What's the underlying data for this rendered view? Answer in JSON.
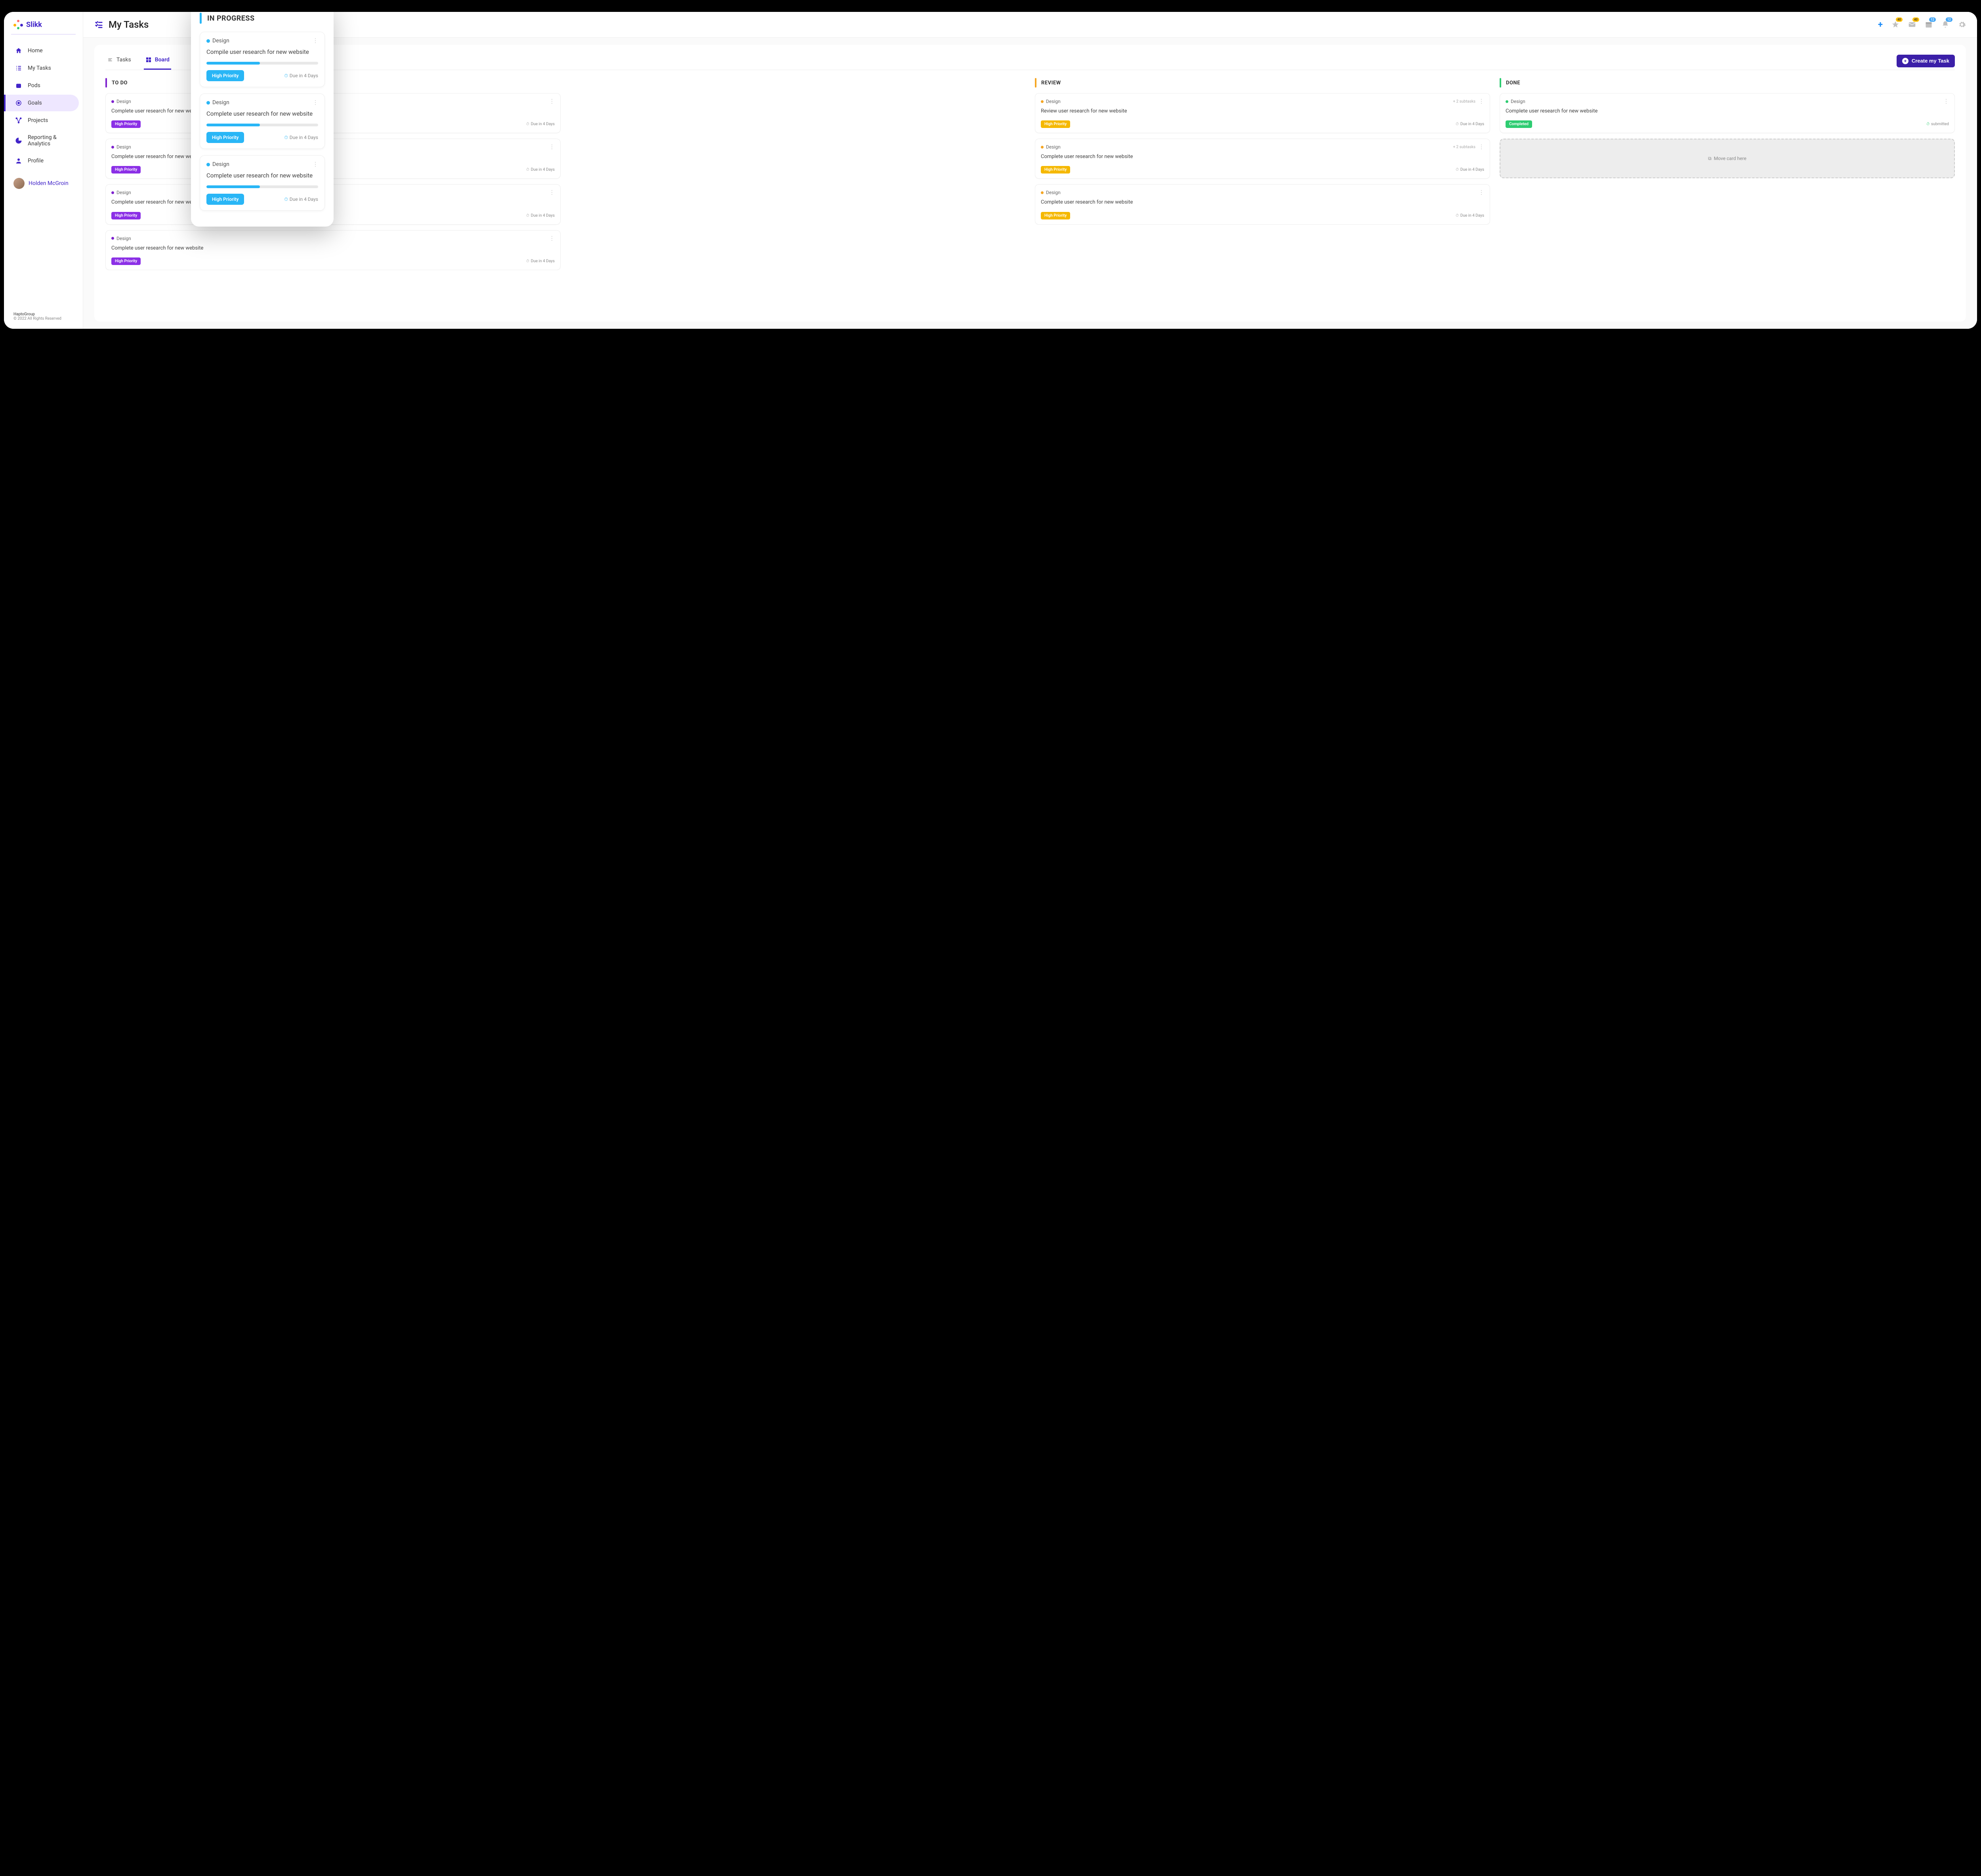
{
  "brand": {
    "name": "Slikk"
  },
  "sidebar": {
    "items": [
      {
        "label": "Home",
        "icon": "home-icon"
      },
      {
        "label": "My Tasks",
        "icon": "tasks-icon"
      },
      {
        "label": "Pods",
        "icon": "pods-icon"
      },
      {
        "label": "Goals",
        "icon": "goals-icon",
        "active": true
      },
      {
        "label": "Projects",
        "icon": "projects-icon"
      },
      {
        "label": "Reporting & Analytics",
        "icon": "analytics-icon"
      },
      {
        "label": "Profile",
        "icon": "profile-icon"
      }
    ],
    "user": {
      "name": "Holden McGroin"
    },
    "footer": {
      "company": "HaptoGroup",
      "rights": "© 2022 All Rights Reserved"
    }
  },
  "header": {
    "title": "My Tasks",
    "badges": {
      "star": "40",
      "mail": "40",
      "cal": "12",
      "bell": "12"
    }
  },
  "views": {
    "tasks_label": "Tasks",
    "board_label": "Board",
    "create_label": "Create my Task"
  },
  "colors": {
    "todo": "#7e22ce",
    "review": "#f5a623",
    "done": "#2ecc71",
    "inprogress": "#29b6f6",
    "pill_purple": "#8b2fe6",
    "pill_yellow": "#f5b800",
    "pill_green": "#2ecc71"
  },
  "columns": {
    "todo": {
      "title": "TO DO",
      "cards": [
        {
          "category": "Design",
          "title": "Complete user research for new website",
          "pill": "High Priority",
          "due": "Due in 4 Days"
        },
        {
          "category": "Design",
          "title": "Complete user research for new website",
          "pill": "High Priority",
          "due": "Due in 4 Days"
        },
        {
          "category": "Design",
          "title": "Complete user research for new website",
          "pill": "High Priority",
          "due": "Due in 4 Days"
        },
        {
          "category": "Design",
          "title": "Complete user research for new website",
          "pill": "High Priority",
          "due": "Due in 4 Days"
        }
      ]
    },
    "review": {
      "title": "REVIEW",
      "cards": [
        {
          "category": "Design",
          "subtasks": "+ 2 subtasks",
          "title": "Review user research for new website",
          "pill": "High Priority",
          "due": "Due in 4 Days"
        },
        {
          "category": "Design",
          "subtasks": "+ 2 subtasks",
          "title": "Complete user research for new website",
          "pill": "High Priority",
          "due": "Due in 4 Days"
        },
        {
          "category": "Design",
          "title": "Complete user research for new website",
          "pill": "High Priority",
          "due": "Due in 4 Days"
        }
      ]
    },
    "done": {
      "title": "DONE",
      "cards": [
        {
          "category": "Design",
          "title": "Complete user research for new website",
          "pill": "Completed",
          "status": "submitted"
        }
      ],
      "drop_label": "Move card here"
    }
  },
  "popover": {
    "title": "IN PROGRESS",
    "cards": [
      {
        "category": "Design",
        "title": "Compile user research for new website",
        "progress": 48,
        "pill": "High Priority",
        "due": "Due in 4 Days"
      },
      {
        "category": "Design",
        "title": "Complete user research for new website",
        "progress": 48,
        "pill": "High Priority",
        "due": "Due in 4 Days"
      },
      {
        "category": "Design",
        "title": "Complete user research for new website",
        "progress": 48,
        "pill": "High Priority",
        "due": "Due in 4 Days"
      }
    ]
  }
}
